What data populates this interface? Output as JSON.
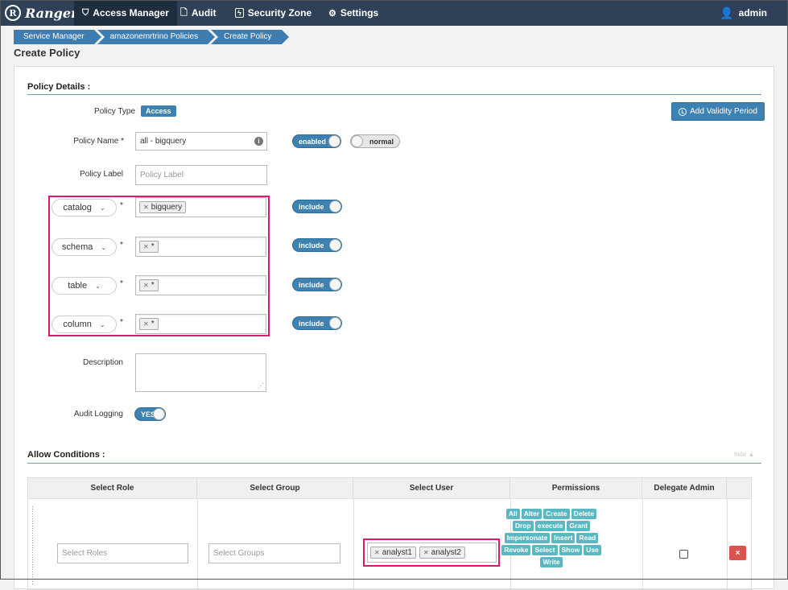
{
  "nav": {
    "brand": "Ranger",
    "brand_logo": "R",
    "items": [
      {
        "label": "Access Manager",
        "icon": "shield-icon"
      },
      {
        "label": "Audit",
        "icon": "file-icon"
      },
      {
        "label": "Security Zone",
        "icon": "bolt-icon"
      },
      {
        "label": "Settings",
        "icon": "gear-icon"
      }
    ],
    "user": "admin"
  },
  "breadcrumb": [
    "Service Manager",
    "amazonemrtrino Policies",
    "Create Policy"
  ],
  "page_title": "Create Policy",
  "policy_details": {
    "title": "Policy Details :",
    "policy_type_label": "Policy Type",
    "policy_type_value": "Access",
    "validity_button": "Add Validity Period",
    "policy_name_label": "Policy Name *",
    "policy_name_value": "all - bigquery",
    "enabled_toggle": "enabled",
    "normal_toggle": "normal",
    "policy_label_label": "Policy Label",
    "policy_label_placeholder": "Policy Label",
    "resources": [
      {
        "type": "catalog",
        "values": [
          "bigquery"
        ],
        "include": "include"
      },
      {
        "type": "schema",
        "values": [
          "*"
        ],
        "include": "include"
      },
      {
        "type": "table",
        "values": [
          "*"
        ],
        "include": "include"
      },
      {
        "type": "column",
        "values": [
          "*"
        ],
        "include": "include"
      }
    ],
    "required_mark": "*",
    "description_label": "Description",
    "audit_logging_label": "Audit Logging",
    "audit_logging_value": "YES"
  },
  "allow_conditions": {
    "title": "Allow Conditions :",
    "hide_link": "hide ▲",
    "columns": [
      "Select Role",
      "Select Group",
      "Select User",
      "Permissions",
      "Delegate Admin"
    ],
    "roles_placeholder": "Select Roles",
    "groups_placeholder": "Select Groups",
    "users": [
      "analyst1",
      "analyst2"
    ],
    "permissions": [
      "All",
      "Alter",
      "Create",
      "Delete",
      "Drop",
      "execute",
      "Grant",
      "Impersonate",
      "Insert",
      "Read",
      "Revoke",
      "Select",
      "Show",
      "Use",
      "Write"
    ],
    "delete_label": "×"
  },
  "colors": {
    "nav_bg": "#2e4156",
    "accent": "#3d82b1",
    "highlight": "#e0186c",
    "permission_tag": "#5bb7c2",
    "delete": "#d9534f"
  }
}
